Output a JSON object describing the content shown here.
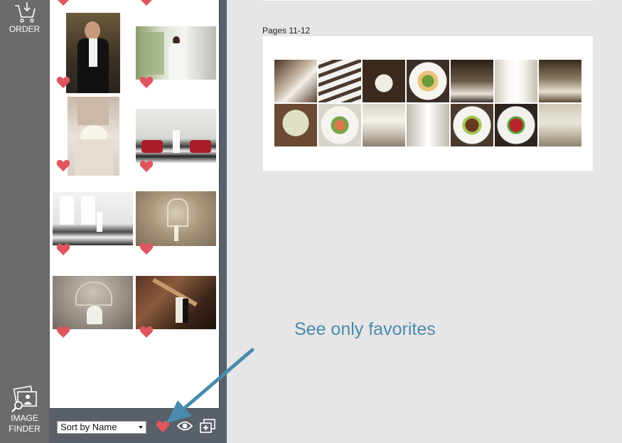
{
  "rail": {
    "order_label": "ORDER",
    "image_finder_label_1": "IMAGE",
    "image_finder_label_2": "FINDER"
  },
  "panel": {
    "sort_value": "Sort by Name",
    "thumbnails": [
      {
        "kind": "groom portrait",
        "favorite": true
      },
      {
        "kind": "bride at window",
        "favorite": true
      },
      {
        "kind": "bride bouquet",
        "favorite": true
      },
      {
        "kind": "red chairs room",
        "favorite": true
      },
      {
        "kind": "bright windows hall",
        "favorite": true
      },
      {
        "kind": "chapel aisle",
        "favorite": true
      },
      {
        "kind": "hall dance",
        "favorite": true
      },
      {
        "kind": "staircase couple",
        "favorite": true
      }
    ]
  },
  "main": {
    "page_label": "Pages 11-12",
    "collage_tiles": [
      "bride veil",
      "place cards",
      "card holder",
      "plated salad",
      "branch centerpiece",
      "wedding cake",
      "reception hall",
      "flower arrangement",
      "salad plate",
      "table setting",
      "tall cake",
      "steak plate",
      "dessert plate",
      "banquet room"
    ]
  },
  "callout": {
    "text": "See only favorites"
  },
  "colors": {
    "rail": "#6b6b6b",
    "panel": "#59606a",
    "heart": "#e0555e",
    "callout": "#4a8bad",
    "background": "#e6e6e6"
  }
}
